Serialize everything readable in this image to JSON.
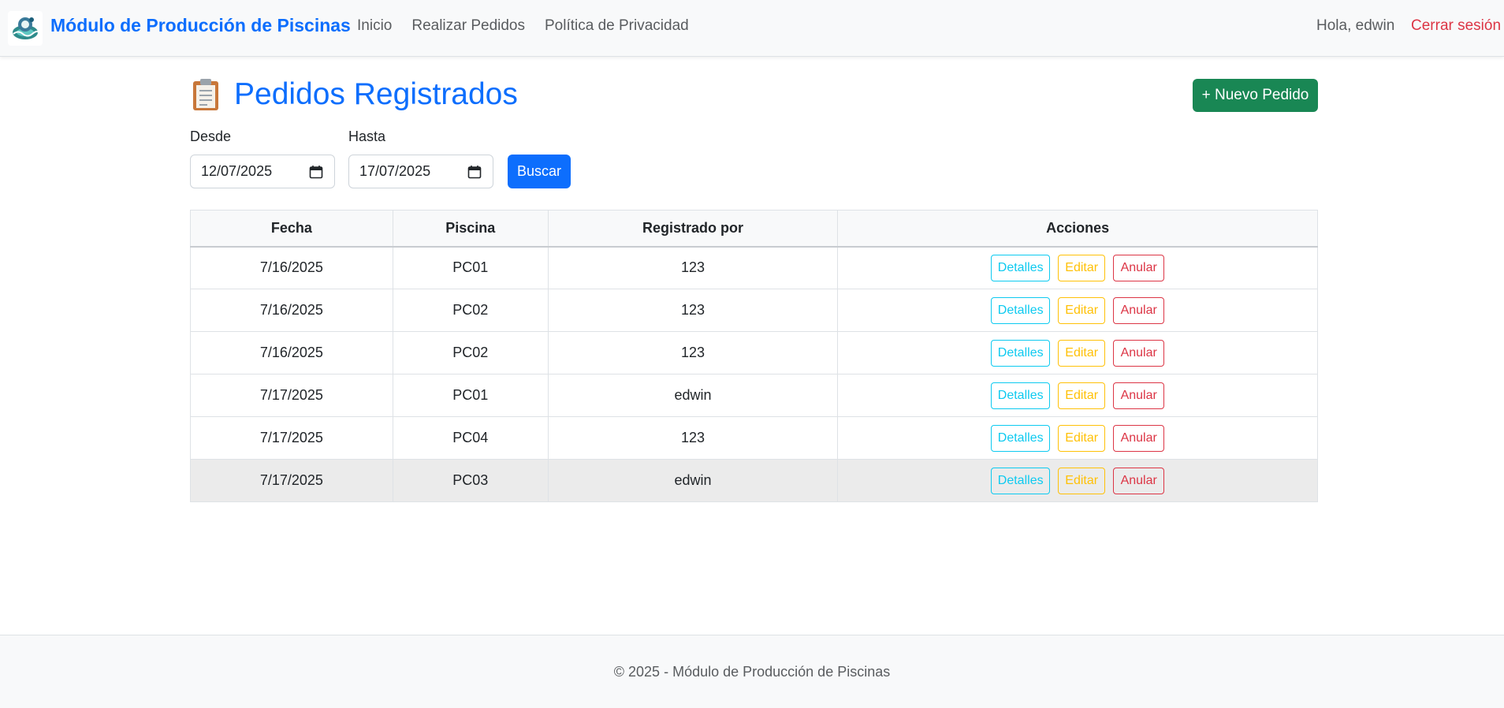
{
  "navbar": {
    "brand": "Módulo de Producción de Piscinas",
    "links": [
      "Inicio",
      "Realizar Pedidos",
      "Política de Privacidad"
    ],
    "greeting": "Hola, edwin",
    "logout": "Cerrar sesión"
  },
  "page": {
    "title": "Pedidos Registrados",
    "new_order_label": "+ Nuevo Pedido"
  },
  "filters": {
    "from_label": "Desde",
    "from_value": "12/07/2025",
    "to_label": "Hasta",
    "to_value": "17/07/2025",
    "search_label": "Buscar"
  },
  "table": {
    "headers": [
      "Fecha",
      "Piscina",
      "Registrado por",
      "Acciones"
    ],
    "rows": [
      {
        "fecha": "7/16/2025",
        "piscina": "PC01",
        "registrado": "123"
      },
      {
        "fecha": "7/16/2025",
        "piscina": "PC02",
        "registrado": "123"
      },
      {
        "fecha": "7/16/2025",
        "piscina": "PC02",
        "registrado": "123"
      },
      {
        "fecha": "7/17/2025",
        "piscina": "PC01",
        "registrado": "edwin"
      },
      {
        "fecha": "7/17/2025",
        "piscina": "PC04",
        "registrado": "123"
      },
      {
        "fecha": "7/17/2025",
        "piscina": "PC03",
        "registrado": "edwin"
      }
    ],
    "actions": {
      "details": "Detalles",
      "edit": "Editar",
      "cancel": "Anular"
    }
  },
  "footer": {
    "text": "© 2025 - Módulo de Producción de Piscinas"
  },
  "colors": {
    "primary": "#0d6efd",
    "success": "#198754",
    "danger": "#dc3545",
    "info": "#0dcaf0",
    "warning": "#ffc107"
  },
  "icons": {
    "logo": "pool-logo-icon",
    "title": "clipboard-icon",
    "date": "calendar-icon"
  }
}
